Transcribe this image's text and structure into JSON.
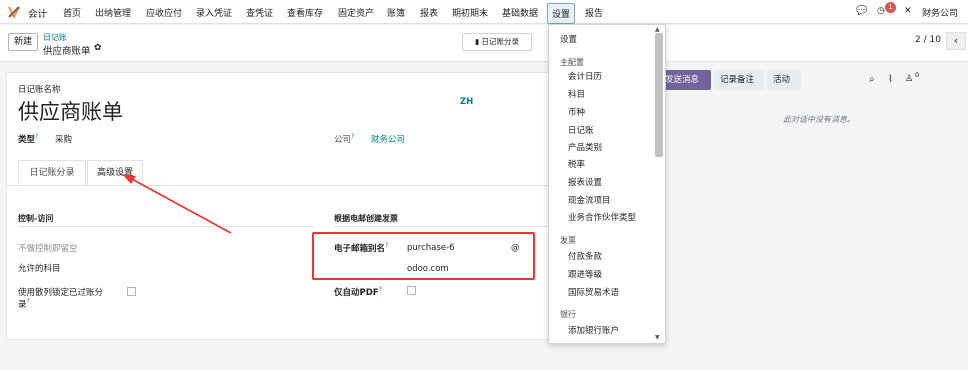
{
  "topnav": {
    "app_name": "会计",
    "menu": [
      "首页",
      "出纳管理",
      "应收应付",
      "录入凭证",
      "查凭证",
      "查看库存",
      "固定资产",
      "账簿",
      "报表",
      "期初期末",
      "基础数据",
      "设置",
      "报告"
    ],
    "notification_count": "1",
    "company": "财务公司"
  },
  "controlbar": {
    "new_button": "新建",
    "breadcrumb_parent": "日记账",
    "breadcrumb_current": "供应商账单",
    "journal_entries_button": "日记账分录",
    "pager": "2 / 10"
  },
  "form": {
    "journal_name_label": "日记账名称",
    "journal_name": "供应商账单",
    "lang": "ZH",
    "type_label": "类型",
    "type_value": "采购",
    "company_label": "公司",
    "company_value": "财务公司",
    "tabs": [
      "日记账分录",
      "高级设置"
    ],
    "section_left": "控制-访问",
    "section_right": "根据电邮创建发票",
    "no_control_placeholder": "不做控制即留空",
    "allowed_accounts_label": "允许的科目",
    "lock_posted_label_1": "使用散列锁定已过账分",
    "lock_posted_label_2": "录",
    "email_alias_label": "电子邮箱别名",
    "email_alias_value": "purchase-6",
    "email_domain": "odoo.com",
    "at_sign": "@",
    "auto_pdf_label": "仅自动PDF"
  },
  "chatter": {
    "send_message": "发送消息",
    "log_note": "记录备注",
    "activity": "活动",
    "followers_count": "0",
    "empty_text": "此对话中没有消息。"
  },
  "dropdown": {
    "top": "设置",
    "groups": [
      {
        "header": "主配置",
        "items": [
          "会计日历",
          "科目",
          "币种",
          "日记账",
          "产品类别",
          "税率",
          "报表设置",
          "现金流项目",
          "业务合作伙伴类型"
        ]
      },
      {
        "header": "发票",
        "items": [
          "付款条款",
          "跟进等级",
          "国际贸易术语"
        ]
      },
      {
        "header": "银行",
        "items": [
          "添加银行账户"
        ]
      }
    ]
  },
  "colors": {
    "accent": "#017e84",
    "primary_button": "#71639e",
    "highlight": "#e53935"
  }
}
